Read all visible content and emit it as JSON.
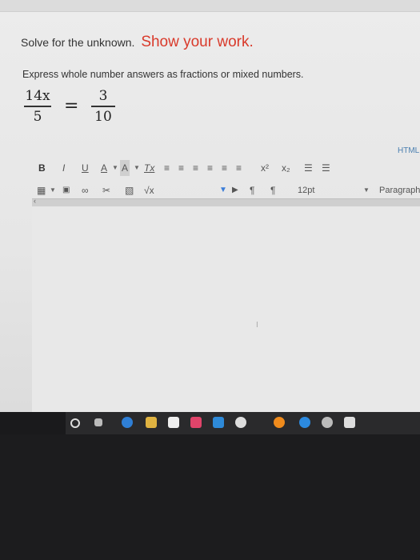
{
  "question": {
    "prefix": "Solve for the unknown.",
    "emphasis": "Show your work."
  },
  "instruction": "Express whole number answers as fractions or mixed numbers.",
  "equation": {
    "left_num": "14x",
    "left_den": "5",
    "sign": "=",
    "right_num": "3",
    "right_den": "10"
  },
  "editor": {
    "html_label": "HTML",
    "toolbar_row1": {
      "bold": "B",
      "italic": "I",
      "underline": "U",
      "font_color": "A",
      "bg_color": "A",
      "clear_format": "Tx",
      "superscript": "x²",
      "subscript": "x₂"
    },
    "toolbar_row2": {
      "font_size": "12pt",
      "format": "Paragraph"
    }
  },
  "colors": {
    "emphasis": "#d93a2b",
    "link": "#4a7fb0"
  }
}
